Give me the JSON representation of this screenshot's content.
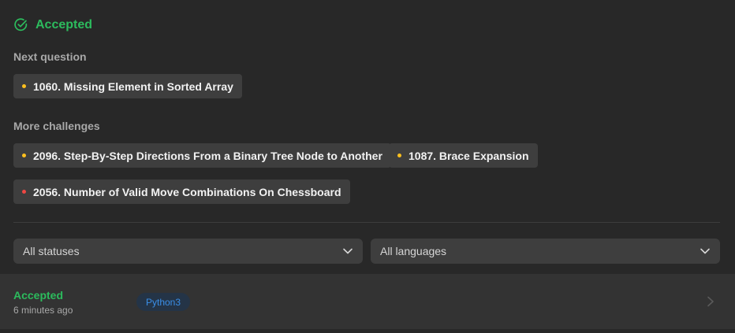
{
  "status": {
    "text": "Accepted",
    "color": "#2cbb5d"
  },
  "next_question": {
    "label": "Next question",
    "item": {
      "title": "1060. Missing Element in Sorted Array",
      "difficulty_color": "#ffc01e"
    }
  },
  "more_challenges": {
    "label": "More challenges",
    "items": [
      {
        "title": "2096. Step-By-Step Directions From a Binary Tree Node to Another",
        "difficulty_color": "#ffc01e"
      },
      {
        "title": "1087. Brace Expansion",
        "difficulty_color": "#ffc01e"
      },
      {
        "title": "2056. Number of Valid Move Combinations On Chessboard",
        "difficulty_color": "#ef4743"
      }
    ]
  },
  "filters": {
    "status_select": "All statuses",
    "language_select": "All languages"
  },
  "submission": {
    "result": "Accepted",
    "time": "6 minutes ago",
    "language": "Python3"
  },
  "icons": {
    "status": "check-circle-icon",
    "select": "chevron-down-icon",
    "row": "chevron-right-icon"
  }
}
